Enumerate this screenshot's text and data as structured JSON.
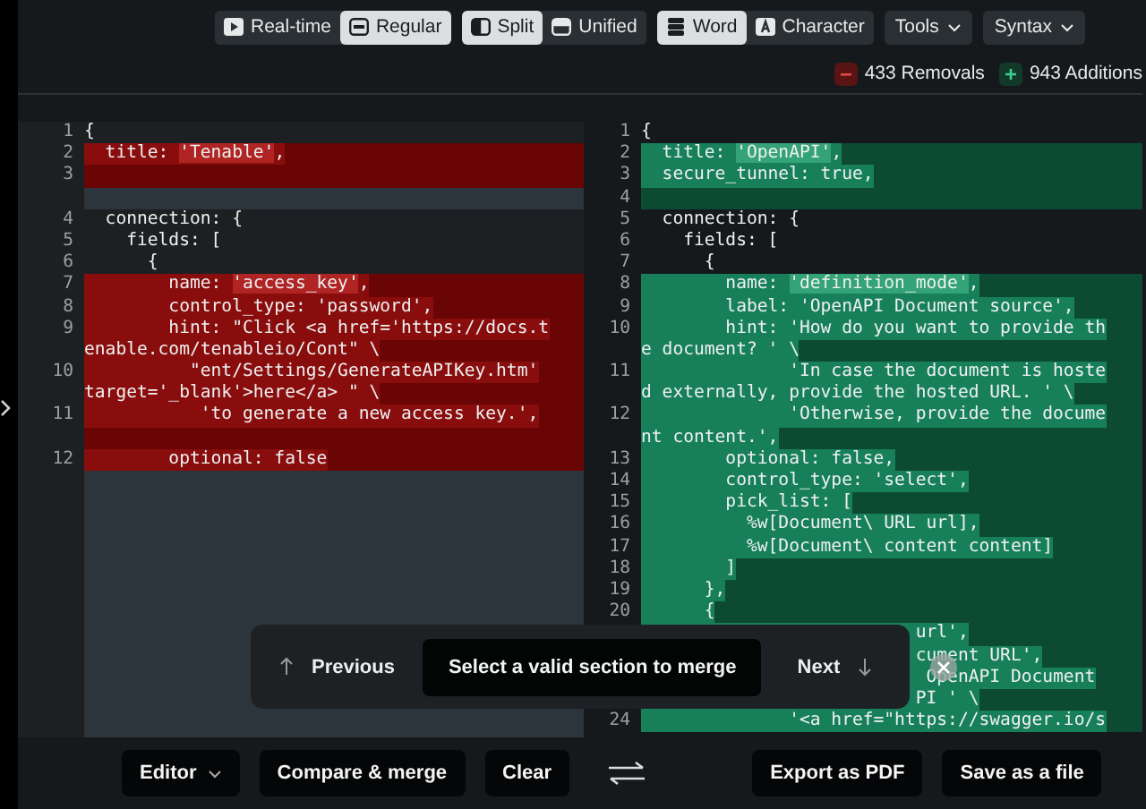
{
  "toolbar": {
    "groups": [
      {
        "options": [
          {
            "label": "Real-time",
            "selected": false
          },
          {
            "label": "Regular",
            "selected": true
          }
        ]
      },
      {
        "options": [
          {
            "label": "Split",
            "selected": true
          },
          {
            "label": "Unified",
            "selected": false
          }
        ]
      },
      {
        "options": [
          {
            "label": "Word",
            "selected": true
          },
          {
            "label": "Character",
            "selected": false
          }
        ]
      }
    ],
    "menus": [
      {
        "label": "Tools"
      },
      {
        "label": "Syntax"
      }
    ]
  },
  "stats": [
    {
      "kind": "removals",
      "label": "433 Removals"
    },
    {
      "kind": "additions",
      "label": "943 Additions"
    }
  ],
  "panes": [
    {
      "kind": "removed",
      "rows": [
        {
          "kind": "line",
          "num": "1",
          "text": "{",
          "changed": false
        },
        {
          "kind": "line",
          "num": "2",
          "changed": true,
          "parts": [
            {
              "text": "  title: ",
              "hl": false
            },
            {
              "text": "'Tenable'",
              "hl": true
            },
            {
              "text": ",",
              "hl": false
            }
          ]
        },
        {
          "kind": "line",
          "num": "3",
          "changed": true
        },
        {
          "kind": "gap"
        },
        {
          "kind": "line",
          "num": "4",
          "text": "  connection: {",
          "changed": false
        },
        {
          "kind": "line",
          "num": "5",
          "text": "    fields: [",
          "changed": false
        },
        {
          "kind": "line",
          "num": "6",
          "text": "      {",
          "changed": false
        },
        {
          "kind": "line",
          "num": "7",
          "changed": true,
          "parts": [
            {
              "text": "        name: ",
              "hl": false
            },
            {
              "text": "'access_key'",
              "hl": true
            },
            {
              "text": ",",
              "hl": false
            }
          ]
        },
        {
          "kind": "line",
          "num": "8",
          "text": "        control_type: 'password',",
          "changed": true
        },
        {
          "kind": "line",
          "num": "9",
          "text": "        hint: \"Click <a href='https://docs.t",
          "changed": true
        },
        {
          "kind": "wrap",
          "text": "enable.com/tenableio/Cont\" \\",
          "changed": true
        },
        {
          "kind": "line",
          "num": "10",
          "text": "          \"ent/Settings/GenerateAPIKey.htm'",
          "changed": true
        },
        {
          "kind": "wrap",
          "text": "target='_blank'>here</a> \" \\",
          "changed": true
        },
        {
          "kind": "line",
          "num": "11",
          "text": "           'to generate a new access key.',",
          "changed": true
        },
        {
          "kind": "wrap",
          "changed": true
        },
        {
          "kind": "line",
          "num": "12",
          "text": "        optional: false",
          "changed": true
        }
      ]
    },
    {
      "kind": "added",
      "rows": [
        {
          "kind": "line",
          "num": "1",
          "text": "{",
          "changed": false
        },
        {
          "kind": "line",
          "num": "2",
          "changed": true,
          "parts": [
            {
              "text": "  title: ",
              "hl": false
            },
            {
              "text": "'OpenAPI'",
              "hl": true
            },
            {
              "text": ",",
              "hl": false
            }
          ]
        },
        {
          "kind": "line",
          "num": "3",
          "text": "  secure_tunnel: true,",
          "changed": true
        },
        {
          "kind": "line",
          "num": "4",
          "changed": true
        },
        {
          "kind": "line",
          "num": "5",
          "text": "  connection: {",
          "changed": false
        },
        {
          "kind": "line",
          "num": "6",
          "text": "    fields: [",
          "changed": false
        },
        {
          "kind": "line",
          "num": "7",
          "text": "      {",
          "changed": false
        },
        {
          "kind": "line",
          "num": "8",
          "changed": true,
          "parts": [
            {
              "text": "        name: ",
              "hl": false
            },
            {
              "text": "'definition_mode'",
              "hl": true
            },
            {
              "text": ",",
              "hl": false
            }
          ]
        },
        {
          "kind": "line",
          "num": "9",
          "text": "        label: 'OpenAPI Document source',",
          "changed": true
        },
        {
          "kind": "line",
          "num": "10",
          "text": "        hint: 'How do you want to provide th",
          "changed": true
        },
        {
          "kind": "wrap",
          "text": "e document? ' \\",
          "changed": true
        },
        {
          "kind": "line",
          "num": "11",
          "text": "              'In case the document is hoste",
          "changed": true
        },
        {
          "kind": "wrap",
          "text": "d externally, provide the hosted URL. ' \\",
          "changed": true
        },
        {
          "kind": "line",
          "num": "12",
          "text": "              'Otherwise, provide the docume",
          "changed": true
        },
        {
          "kind": "wrap",
          "text": "nt content.',",
          "changed": true
        },
        {
          "kind": "line",
          "num": "13",
          "text": "        optional: false,",
          "changed": true
        },
        {
          "kind": "line",
          "num": "14",
          "text": "        control_type: 'select',",
          "changed": true
        },
        {
          "kind": "line",
          "num": "15",
          "text": "        pick_list: [",
          "changed": true
        },
        {
          "kind": "line",
          "num": "16",
          "text": "          %w[Document\\ URL url],",
          "changed": true
        },
        {
          "kind": "line",
          "num": "17",
          "text": "          %w[Document\\ content content]",
          "changed": true
        },
        {
          "kind": "line",
          "num": "18",
          "text": "        ]",
          "changed": true
        },
        {
          "kind": "line",
          "num": "19",
          "text": "      },",
          "changed": true
        },
        {
          "kind": "line",
          "num": "20",
          "text": "      {",
          "changed": true
        },
        {
          "kind": "wrap",
          "text": "                          url',",
          "changed": true
        },
        {
          "kind": "wrap",
          "text": "                          cument URL',",
          "changed": true
        },
        {
          "kind": "wrap",
          "text": "                           OpenAPI Document",
          "changed": true
        },
        {
          "kind": "wrap",
          "text": "                          PI ' \\",
          "changed": true
        },
        {
          "kind": "line",
          "num": "24",
          "text": "              '<a href=\"https://swagger.io/s",
          "changed": true
        }
      ]
    }
  ],
  "merge_bar": {
    "previous": "Previous",
    "message": "Select a valid section to merge",
    "next": "Next"
  },
  "bottom_bar": {
    "left": [
      {
        "label": "Editor",
        "dropdown": true
      },
      {
        "label": "Compare & merge",
        "dropdown": false
      },
      {
        "label": "Clear",
        "dropdown": false
      }
    ],
    "right": [
      {
        "label": "Export as PDF"
      },
      {
        "label": "Save as a file"
      }
    ]
  }
}
